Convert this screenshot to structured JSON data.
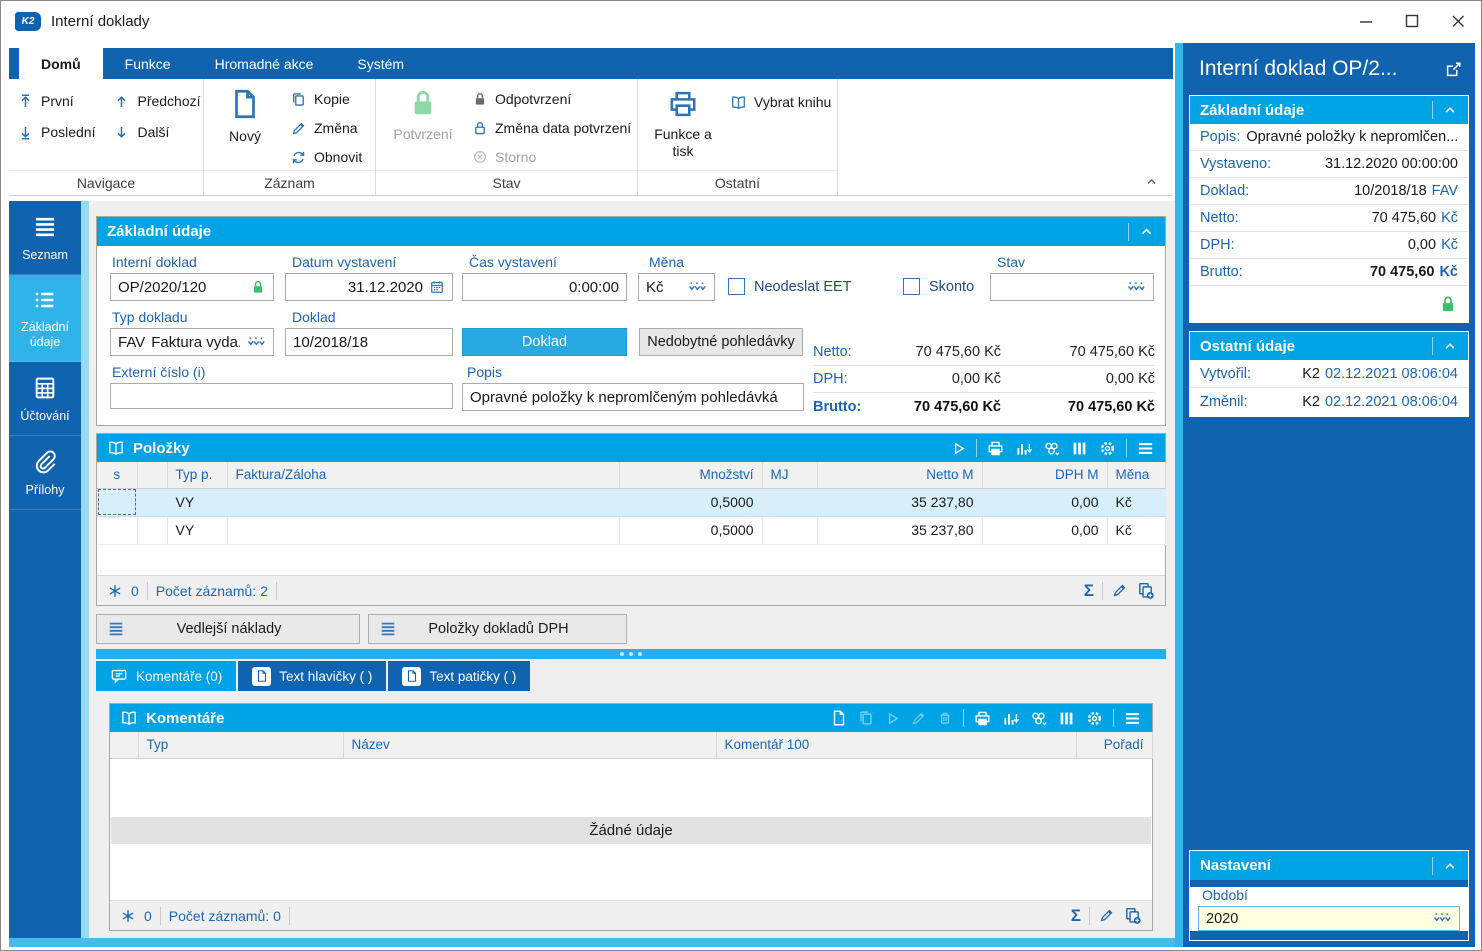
{
  "window": {
    "title": "Interní doklady",
    "logo": "K2"
  },
  "ribbon": {
    "tabs": [
      {
        "label": "Domů"
      },
      {
        "label": "Funkce"
      },
      {
        "label": "Hromadné akce"
      },
      {
        "label": "Systém"
      }
    ],
    "navigace": {
      "label": "Navigace",
      "prvni": "První",
      "predchozi": "Předchozí",
      "posledni": "Poslední",
      "dalsi": "Další"
    },
    "zaznam": {
      "label": "Záznam",
      "novy": "Nový",
      "kopie": "Kopie",
      "zmena": "Změna",
      "obnovit": "Obnovit"
    },
    "stav": {
      "label": "Stav",
      "potvrzeni": "Potvrzení",
      "odpotvrzeni": "Odpotvrzení",
      "zmena_data": "Změna data potvrzení",
      "storno": "Storno"
    },
    "ostatni": {
      "label": "Ostatní",
      "funkce_tisk": "Funkce a tisk",
      "vybrat_knihu": "Vybrat knihu"
    }
  },
  "sidebar": {
    "items": [
      {
        "label": "Seznam"
      },
      {
        "label": "Základní údaje"
      },
      {
        "label": "Účtování"
      },
      {
        "label": "Přílohy"
      }
    ]
  },
  "form": {
    "title": "Základní údaje",
    "interni_doklad": {
      "label": "Interní doklad",
      "value": "OP/2020/120"
    },
    "datum": {
      "label": "Datum vystavení",
      "value": "31.12.2020"
    },
    "cas": {
      "label": "Čas vystavení",
      "value": "0:00:00"
    },
    "mena": {
      "label": "Měna",
      "value": "Kč"
    },
    "neodeslat_eet": {
      "label": "Neodeslat EET"
    },
    "skonto": {
      "label": "Skonto"
    },
    "stav": {
      "label": "Stav",
      "value": ""
    },
    "typ_dokladu": {
      "label": "Typ dokladu",
      "code": "FAV",
      "value": "Faktura vyda..."
    },
    "doklad": {
      "label": "Doklad",
      "value": "10/2018/18"
    },
    "doklad_button": "Doklad",
    "nedobytne_button": "Nedobytné pohledávky",
    "externi_cislo": {
      "label": "Externí číslo (i)",
      "value": ""
    },
    "popis": {
      "label": "Popis",
      "value": "Opravné položky k nepromlčeným pohledávká"
    },
    "totals": [
      {
        "label": "Netto:",
        "value1": "70 475,60 Kč",
        "value2": "70 475,60 Kč"
      },
      {
        "label": "DPH:",
        "value1": "0,00 Kč",
        "value2": "0,00 Kč"
      },
      {
        "label": "Brutto:",
        "value1": "70 475,60 Kč",
        "value2": "70 475,60 Kč"
      }
    ]
  },
  "polozky": {
    "title": "Položky",
    "columns": {
      "s": "s",
      "typ": "Typ p.",
      "faktura": "Faktura/Záloha",
      "mnozstvi": "Množství",
      "mj": "MJ",
      "netto": "Netto M",
      "dph": "DPH M",
      "mena": "Měna"
    },
    "rows": [
      {
        "typ": "VY",
        "faktura": "",
        "mnozstvi": "0,5000",
        "mj": "",
        "netto": "35 237,80",
        "dph": "0,00",
        "mena": "Kč"
      },
      {
        "typ": "VY",
        "faktura": "",
        "mnozstvi": "0,5000",
        "mj": "",
        "netto": "35 237,80",
        "dph": "0,00",
        "mena": "Kč"
      }
    ],
    "status": {
      "flag": "0",
      "count": "Počet záznamů: 2"
    }
  },
  "buttons": {
    "vedlejsi": "Vedlejší náklady",
    "polozky_dph": "Položky dokladů DPH"
  },
  "tabs": {
    "komentare": "Komentáře (0)",
    "hlavicka": "Text hlavičky ( )",
    "paticka": "Text patičky ( )"
  },
  "komentare": {
    "title": "Komentáře",
    "columns": {
      "typ": "Typ",
      "nazev": "Název",
      "komentar": "Komentář 100",
      "poradi": "Pořadí"
    },
    "empty": "Žádné údaje",
    "status": {
      "flag": "0",
      "count": "Počet záznamů: 0"
    }
  },
  "preview": {
    "title": "Interní doklad OP/2...",
    "zakladni": {
      "title": "Základní údaje",
      "rows": [
        {
          "label": "Popis:",
          "value": "Opravné položky k nepromlčen..."
        },
        {
          "label": "Vystaveno:",
          "value": "31.12.2020 00:00:00"
        },
        {
          "label": "Doklad:",
          "value": "10/2018/18",
          "suffix": "FAV"
        },
        {
          "label": "Netto:",
          "value": "70 475,60",
          "suffix": "Kč"
        },
        {
          "label": "DPH:",
          "value": "0,00",
          "suffix": "Kč"
        },
        {
          "label": "Brutto:",
          "value": "70 475,60",
          "suffix": "Kč"
        }
      ]
    },
    "ostatni": {
      "title": "Ostatní údaje",
      "rows": [
        {
          "label": "Vytvořil:",
          "value": "K2",
          "suffix": "02.12.2021 08:06:04"
        },
        {
          "label": "Změnil:",
          "value": "K2",
          "suffix": "02.12.2021 08:06:04"
        }
      ]
    },
    "nastaveni": {
      "title": "Nastavení",
      "obdobi_label": "Období",
      "obdobi_value": "2020"
    }
  },
  "icons": {
    "sigma": "Σ"
  },
  "colors": {
    "accent_dark": "#1063AE",
    "accent_cyan": "#00A4E4",
    "lock_green": "#3DBE6E",
    "selection": "#D7EFFA",
    "period_bg": "#FFFFE1"
  }
}
